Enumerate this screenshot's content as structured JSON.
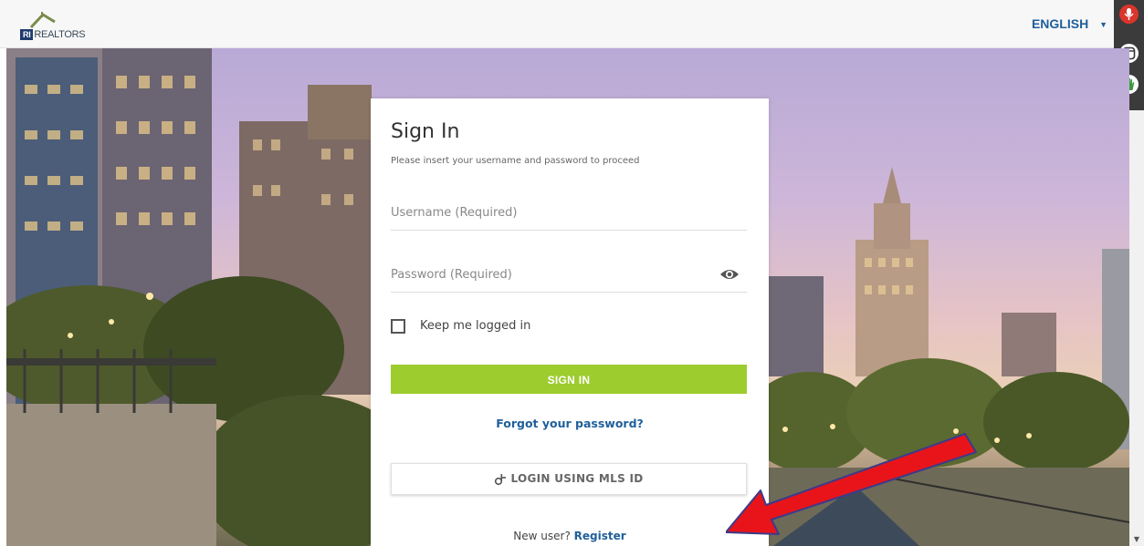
{
  "header": {
    "logo_ri": "RI",
    "logo_text": "REALTORS",
    "language": "ENGLISH"
  },
  "signin": {
    "title": "Sign In",
    "subtitle": "Please insert your username and password to proceed",
    "username_placeholder": "Username (Required)",
    "password_placeholder": "Password (Required)",
    "remember_label": "Keep me logged in",
    "signin_button": "SIGN IN",
    "forgot_link": "Forgot your password?",
    "mls_button": "LOGIN USING MLS ID",
    "new_user_text": "New user?",
    "register_link": "Register"
  },
  "colors": {
    "primary_green": "#9ccc2e",
    "link_blue": "#1f5f9a",
    "annotation_red": "#e8141a"
  },
  "icons": [
    "microphone-icon",
    "window-icon",
    "hand-icon",
    "eye-icon",
    "mls-login-icon",
    "chevron-down-icon"
  ]
}
